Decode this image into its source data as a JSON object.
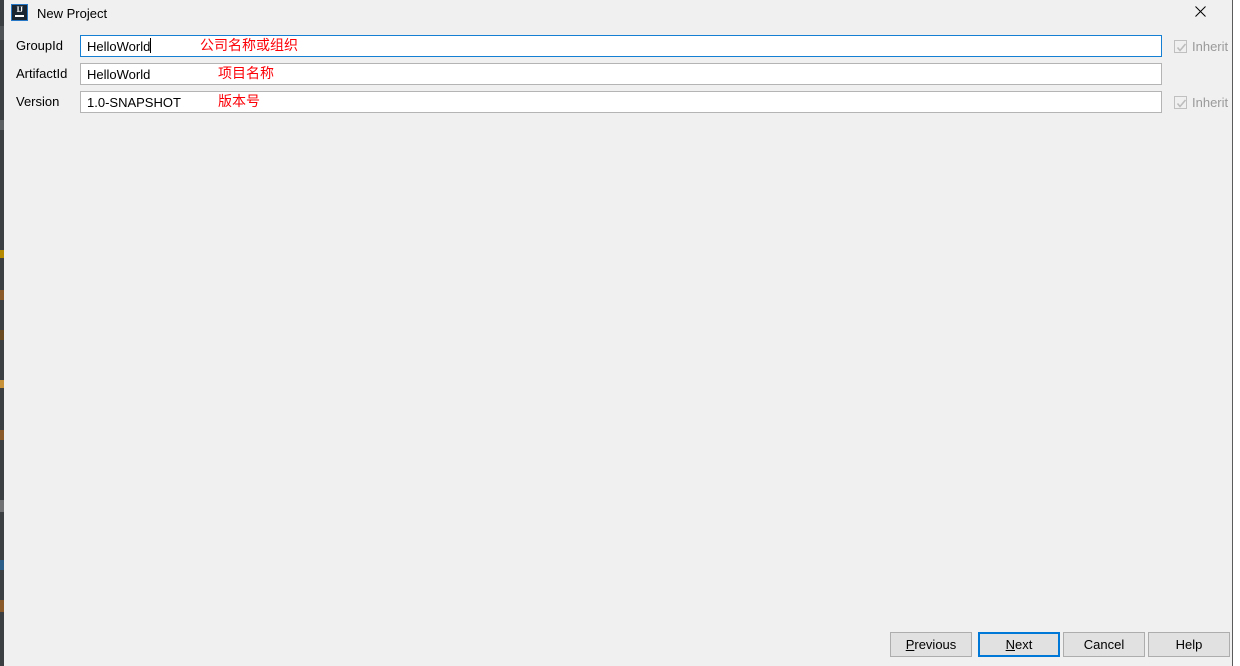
{
  "window": {
    "title": "New Project",
    "app_icon": "intellij-idea-icon",
    "icon_letters": "IJ",
    "close_icon": "close-icon"
  },
  "form": {
    "rows": [
      {
        "label": "GroupId",
        "value": "HelloWorld",
        "annotation": "公司名称或组织",
        "focused": true,
        "has_inherit": true,
        "inherit_label": "Inherit",
        "inherit_checked": true,
        "inherit_disabled": true
      },
      {
        "label": "ArtifactId",
        "value": "HelloWorld",
        "annotation": "项目名称",
        "focused": false,
        "has_inherit": false,
        "inherit_label": "",
        "inherit_checked": false,
        "inherit_disabled": false
      },
      {
        "label": "Version",
        "value": "1.0-SNAPSHOT",
        "annotation": "版本号",
        "focused": false,
        "has_inherit": true,
        "inherit_label": "Inherit",
        "inherit_checked": true,
        "inherit_disabled": true
      }
    ]
  },
  "buttons": {
    "previous": {
      "label": "Previous",
      "mnemonic": "P",
      "default": false
    },
    "next": {
      "label": "Next",
      "mnemonic": "N",
      "default": true
    },
    "cancel": {
      "label": "Cancel",
      "mnemonic": "",
      "default": false
    },
    "help": {
      "label": "Help",
      "mnemonic": "",
      "default": false
    }
  },
  "colors": {
    "dialog_background": "#f0f0f0",
    "focus_blue": "#157fd4",
    "default_button_blue": "#0078d7",
    "annotation_red": "#fb0007",
    "disabled_text": "#9a9a9a"
  }
}
